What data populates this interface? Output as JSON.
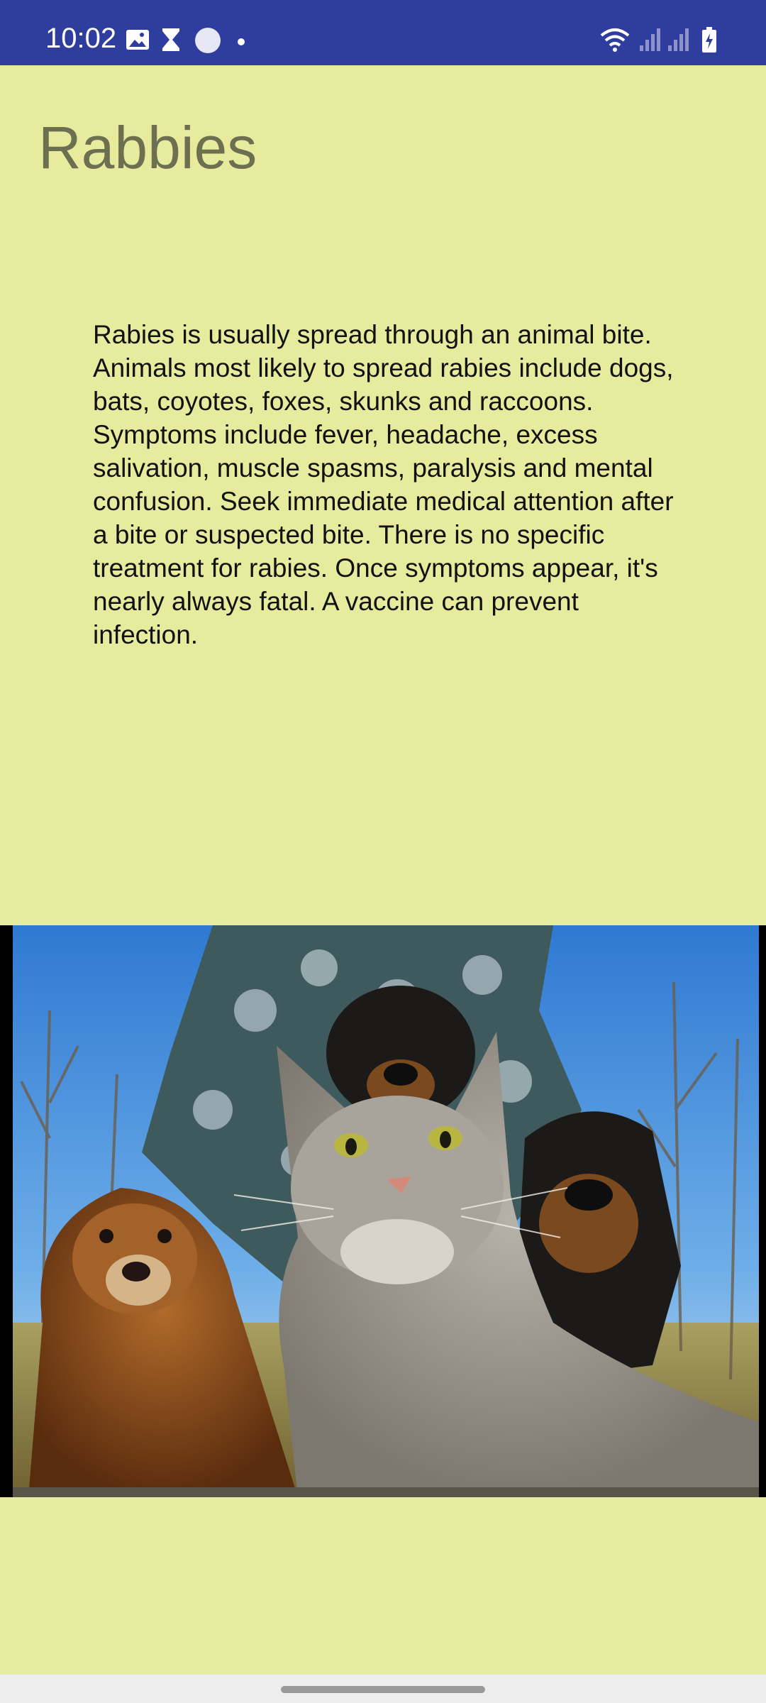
{
  "status_bar": {
    "time": "10:02",
    "left_icons": [
      "image-icon",
      "hourglass-icon",
      "circle-icon",
      "dot-icon"
    ],
    "right_icons": [
      "wifi-icon",
      "signal-icon",
      "signal-icon",
      "battery-charging-icon"
    ]
  },
  "page": {
    "title": "Rabbies",
    "body": "Rabies is usually spread through an animal bite. Animals most likely to spread rabies include dogs, bats, coyotes, foxes, skunks and raccoons. Symptoms include fever, headache, excess salivation, muscle spasms, paralysis and mental confusion. Seek immediate medical attention after a bite or suspected bite. There is no specific treatment for rabies. Once symptoms appear, it's nearly always fatal. A vaccine can prevent infection."
  },
  "colors": {
    "status_bar": "#2f3d9e",
    "background": "#e6eb9e",
    "title": "#6d7050",
    "body_text": "#121212"
  }
}
